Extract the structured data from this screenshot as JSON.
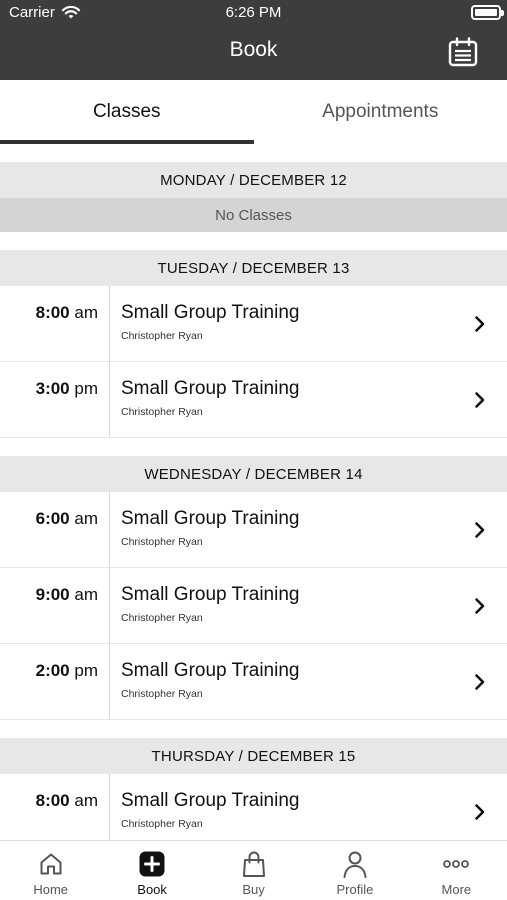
{
  "status_bar": {
    "carrier": "Carrier",
    "time": "6:26 PM"
  },
  "nav": {
    "title": "Book",
    "calendar_icon": "calendar-icon"
  },
  "tabs": [
    {
      "label": "Classes",
      "active": true
    },
    {
      "label": "Appointments",
      "active": false
    }
  ],
  "days": [
    {
      "header": "MONDAY / DECEMBER 12",
      "empty_text": "No Classes",
      "classes": []
    },
    {
      "header": "TUESDAY / DECEMBER 13",
      "classes": [
        {
          "time": "8:00",
          "ampm": "am",
          "name": "Small Group Training",
          "instructor": "Christopher Ryan"
        },
        {
          "time": "3:00",
          "ampm": "pm",
          "name": "Small Group Training",
          "instructor": "Christopher Ryan"
        }
      ]
    },
    {
      "header": "WEDNESDAY / DECEMBER 14",
      "classes": [
        {
          "time": "6:00",
          "ampm": "am",
          "name": "Small Group Training",
          "instructor": "Christopher Ryan"
        },
        {
          "time": "9:00",
          "ampm": "am",
          "name": "Small Group Training",
          "instructor": "Christopher Ryan"
        },
        {
          "time": "2:00",
          "ampm": "pm",
          "name": "Small Group Training",
          "instructor": "Christopher Ryan"
        }
      ]
    },
    {
      "header": "THURSDAY / DECEMBER 15",
      "classes": [
        {
          "time": "8:00",
          "ampm": "am",
          "name": "Small Group Training",
          "instructor": "Christopher Ryan"
        }
      ]
    }
  ],
  "tab_bar": [
    {
      "label": "Home",
      "icon": "home-icon",
      "active": false
    },
    {
      "label": "Book",
      "icon": "plus-icon",
      "active": true
    },
    {
      "label": "Buy",
      "icon": "bag-icon",
      "active": false
    },
    {
      "label": "Profile",
      "icon": "person-icon",
      "active": false
    },
    {
      "label": "More",
      "icon": "more-icon",
      "active": false
    }
  ],
  "colors": {
    "header_bg": "#3d3d3d",
    "day_header_bg": "#e7e7e7",
    "no_classes_bg": "#d4d4d4",
    "active_tab_underline": "#333333"
  }
}
